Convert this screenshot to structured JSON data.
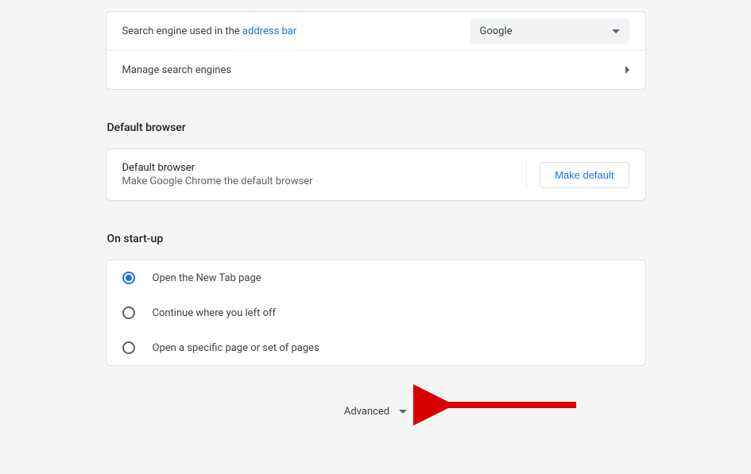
{
  "searchEngine": {
    "labelPrefix": "Search engine used in the ",
    "linkText": "address bar",
    "selected": "Google",
    "manageLabel": "Manage search engines"
  },
  "defaultBrowser": {
    "sectionTitle": "Default browser",
    "title": "Default browser",
    "desc": "Make Google Chrome the default browser",
    "buttonLabel": "Make default"
  },
  "startup": {
    "sectionTitle": "On start-up",
    "options": [
      "Open the New Tab page",
      "Continue where you left off",
      "Open a specific page or set of pages"
    ],
    "selectedIndex": 0
  },
  "advanced": {
    "label": "Advanced"
  }
}
